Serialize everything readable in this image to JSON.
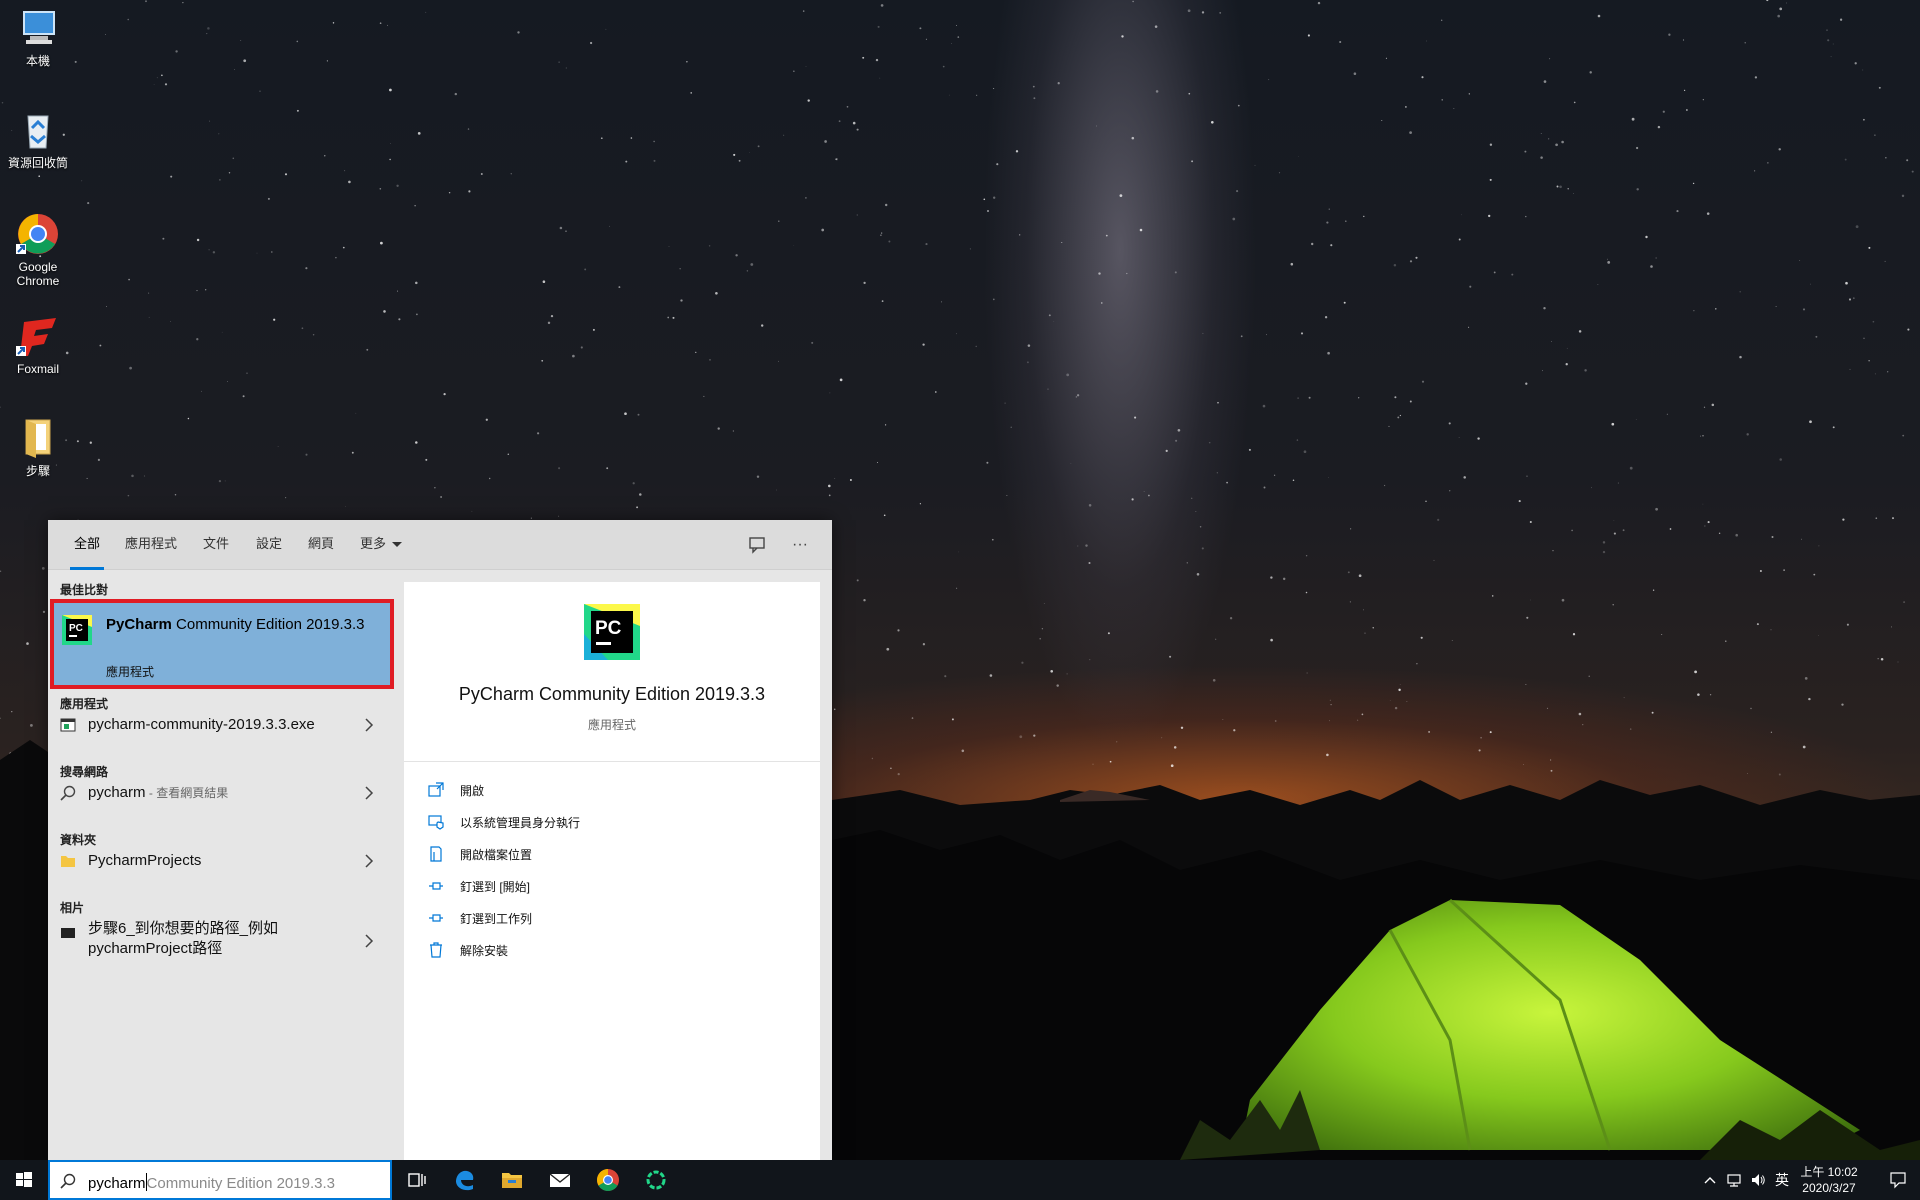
{
  "desktop": {
    "icons": [
      {
        "label": "本機",
        "icon": "computer-icon"
      },
      {
        "label": "資源回收筒",
        "icon": "recycle-bin-icon"
      },
      {
        "label": "Google Chrome",
        "icon": "chrome-icon"
      },
      {
        "label": "Foxmail",
        "icon": "foxmail-icon"
      },
      {
        "label": "步驟",
        "icon": "folder-icon"
      }
    ]
  },
  "search": {
    "tabs": [
      {
        "label": "全部",
        "active": true
      },
      {
        "label": "應用程式"
      },
      {
        "label": "文件"
      },
      {
        "label": "設定"
      },
      {
        "label": "網頁"
      },
      {
        "label": "更多"
      }
    ],
    "bar_icons": [
      "feedback-icon",
      "more-options-icon"
    ],
    "more_glyph": "···",
    "groups": {
      "best_match": "最佳比對",
      "apps": "應用程式",
      "web": "搜尋網路",
      "folders": "資料夾",
      "photos": "相片"
    },
    "best_match": {
      "name_bold": "PyCharm",
      "name_rest": "Community Edition 2019.3.3",
      "kind": "應用程式",
      "icon": "pycharm-icon"
    },
    "results": {
      "app": {
        "label": "pycharm-community-2019.3.3.exe",
        "icon": "exe-icon"
      },
      "web": {
        "label": "pycharm",
        "hint": " - 查看網頁結果",
        "icon": "search-icon"
      },
      "folder": {
        "label": "PycharmProjects",
        "icon": "folder-icon"
      },
      "photo": {
        "line1": "步驟6_到你想要的路徑_例如",
        "line2": "pycharmProject路徑",
        "icon": "image-icon"
      }
    },
    "preview": {
      "title": "PyCharm Community Edition 2019.3.3",
      "kind": "應用程式",
      "icon_text": "PC",
      "actions": [
        {
          "label": "開啟",
          "icon": "open-icon"
        },
        {
          "label": "以系統管理員身分執行",
          "icon": "admin-icon"
        },
        {
          "label": "開啟檔案位置",
          "icon": "file-location-icon"
        },
        {
          "label": "釘選到 [開始]",
          "icon": "pin-icon"
        },
        {
          "label": "釘選到工作列",
          "icon": "pin-icon"
        },
        {
          "label": "解除安裝",
          "icon": "trash-icon"
        }
      ]
    }
  },
  "taskbar": {
    "search_typed": "pycharm",
    "search_suggest": "Community Edition 2019.3.3",
    "pinned": [
      "task-view-icon",
      "edge-icon",
      "file-explorer-icon",
      "mail-icon",
      "chrome-icon",
      "loading-app-icon"
    ],
    "tray": {
      "language": "英",
      "time": "上午 10:02",
      "date": "2020/3/27"
    }
  },
  "colors": {
    "accent": "#0078d7",
    "highlight_border": "#e01c24",
    "selected_bg": "#7fb0d9"
  }
}
